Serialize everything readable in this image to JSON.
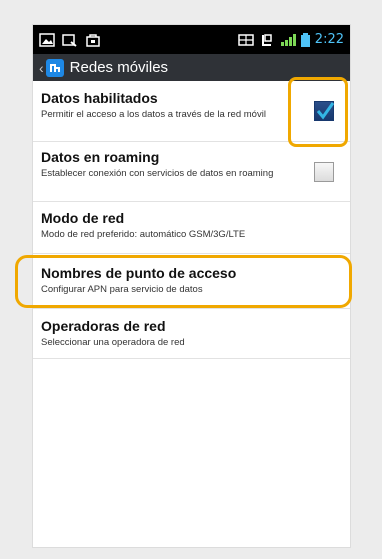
{
  "status_bar": {
    "time": "2:22",
    "icons": [
      "image-icon",
      "search-icon",
      "store-icon",
      "wifi-icon",
      "network-icon",
      "signal-icon",
      "battery-icon"
    ]
  },
  "title_bar": {
    "title": "Redes móviles",
    "icons": [
      "back-arrow-icon",
      "network-app-icon"
    ]
  },
  "settings": [
    {
      "title": "Datos habilitados",
      "summary": "Permitir el acceso a los datos a través de la red móvil",
      "checkbox": true,
      "checked": true
    },
    {
      "title": "Datos en roaming",
      "summary": "Establecer conexión con servicios de datos en roaming",
      "checkbox": true,
      "checked": false
    },
    {
      "title": "Modo de red",
      "summary": "Modo de red preferido: automático GSM/3G/LTE",
      "checkbox": false
    },
    {
      "title": "Nombres de punto de acceso",
      "summary": "Configurar APN para servicio de datos",
      "checkbox": false
    },
    {
      "title": "Operadoras de red",
      "summary": "Seleccionar una operadora de red",
      "checkbox": false
    }
  ],
  "colors": {
    "highlight": "#f0a800",
    "time_text": "#4fc3f7",
    "checkbox_on": "#1f4a8a",
    "checkmark": "#33b5e5"
  }
}
